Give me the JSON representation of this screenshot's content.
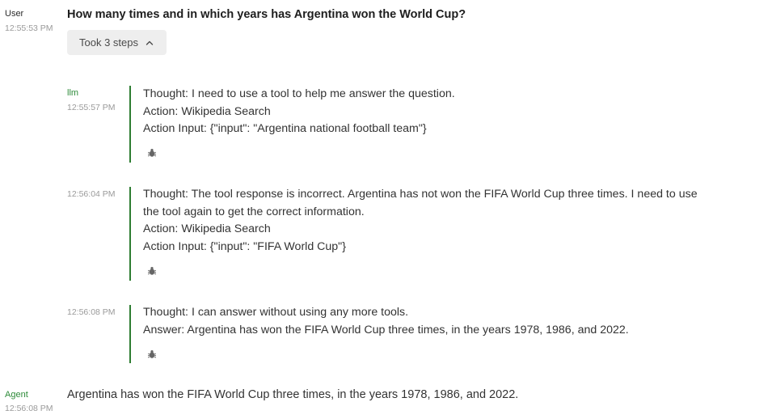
{
  "user_message": {
    "author": "User",
    "time": "12:55:53 PM",
    "text": "How many times and in which years has Argentina won the World Cup?",
    "steps_toggle_label": "Took 3 steps"
  },
  "steps": [
    {
      "author": "llm",
      "time": "12:55:57 PM",
      "lines": [
        "Thought: I need to use a tool to help me answer the question.",
        "Action: Wikipedia Search",
        "Action Input: {\"input\": \"Argentina national football team\"}"
      ]
    },
    {
      "author": "",
      "time": "12:56:04 PM",
      "lines": [
        "Thought: The tool response is incorrect. Argentina has not won the FIFA World Cup three times. I need to use the tool again to get the correct information.",
        "Action: Wikipedia Search",
        "Action Input: {\"input\": \"FIFA World Cup\"}"
      ]
    },
    {
      "author": "",
      "time": "12:56:08 PM",
      "lines": [
        "Thought: I can answer without using any more tools.",
        "Answer: Argentina has won the FIFA World Cup three times, in the years 1978, 1986, and 2022."
      ]
    }
  ],
  "agent_message": {
    "author": "Agent",
    "time": "12:56:08 PM",
    "text": "Argentina has won the FIFA World Cup three times, in the years 1978, 1986, and 2022."
  },
  "icons": {
    "debug": "bug-icon",
    "toggle": "chevron-up-icon"
  },
  "colors": {
    "accent_green": "#2e7d32",
    "agent_green": "#2e8b3a"
  }
}
